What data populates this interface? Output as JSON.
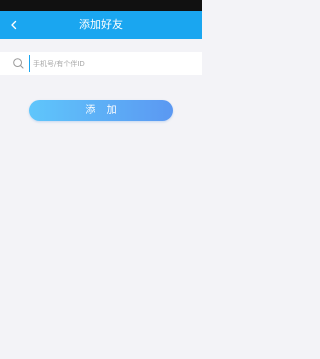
{
  "header": {
    "title": "添加好友",
    "back_icon": "chevron-left-icon"
  },
  "search": {
    "icon": "search-icon",
    "value": "",
    "placeholder": "手机号/有个伴ID"
  },
  "actions": {
    "add_label": "添 加"
  },
  "colors": {
    "header_bg": "#1aa6f0",
    "page_bg": "#f3f3f7",
    "button_gradient_start": "#5fc6fb",
    "button_gradient_end": "#5b98f2"
  }
}
